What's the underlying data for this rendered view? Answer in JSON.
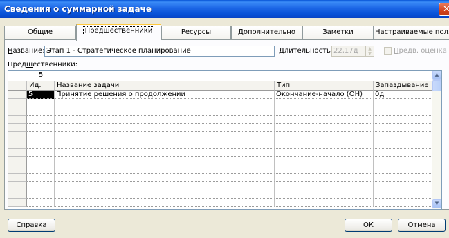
{
  "window": {
    "title": "Сведения о суммарной задаче",
    "close_glyph": "✕"
  },
  "tabs": [
    {
      "label": "Общие"
    },
    {
      "label": "Предшественники"
    },
    {
      "label": "Ресурсы"
    },
    {
      "label": "Дополнительно"
    },
    {
      "label": "Заметки"
    },
    {
      "label": "Настраиваемые поля"
    }
  ],
  "active_tab": "Предшественники",
  "form": {
    "name_label_u": "Н",
    "name_label_rest": "азвание:",
    "name_value": "Этап 1 - Стратегическое планирование",
    "duration_label_u": "Д",
    "duration_label_rest": "лительность:",
    "duration_value": "22,17д",
    "estimate_label_u": "П",
    "estimate_label_rest": "редв. оценка",
    "estimate_checked": false
  },
  "predecessors": {
    "label_u": "Пред",
    "label_u2": "ш",
    "label_rest": "ественники:",
    "edit_value": "5",
    "columns": [
      "Ид.",
      "Название задачи",
      "Тип",
      "Запаздывание"
    ],
    "rows": [
      {
        "id": "5",
        "name": "Принятие решения о продолжении",
        "type": "Окончание-начало (ОН)",
        "lag": "0д"
      }
    ]
  },
  "icons": {
    "scroll_up": "up-arrow-icon",
    "scroll_down": "down-arrow-icon",
    "close": "close-icon"
  },
  "buttons": {
    "help_u": "С",
    "help_rest": "правка",
    "ok": "ОК",
    "cancel": "Отмена"
  },
  "colors": {
    "titlebar": "#0a58d8",
    "dialog_bg": "#ece9d8",
    "active_tab_accent": "#ffc83c",
    "close_button": "#d2421d"
  }
}
